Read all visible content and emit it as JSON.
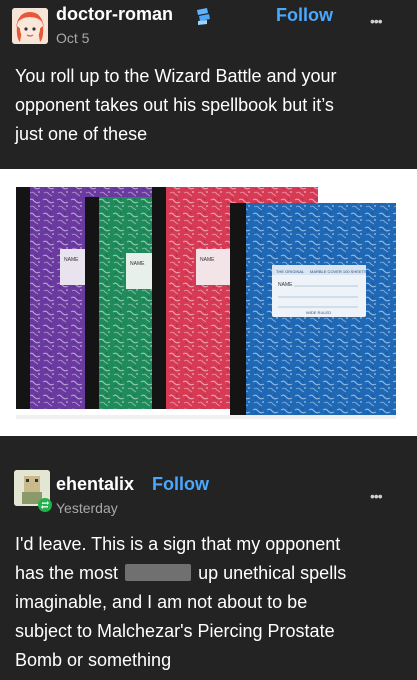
{
  "post1": {
    "username": "doctor-roman",
    "date": "Oct 5",
    "follow_label": "Follow",
    "more_label": "•••",
    "text_lines": [
      "You roll up to the Wizard Battle and your",
      "opponent takes out his spellbook but it’s",
      "just one of these"
    ],
    "notebooks": [
      {
        "color": "#6a3aa0",
        "label": "NAME"
      },
      {
        "color": "#1f8b5a",
        "label": "NAME"
      },
      {
        "color": "#d63a54",
        "label": "NAME"
      },
      {
        "color": "#1f68b6",
        "label": "NAME",
        "header": "THE ORIGINAL",
        "subheader": "MARBLE COVER 100 SHEETS",
        "footer": "WIDE RULED"
      }
    ]
  },
  "post2": {
    "username": "ehentalix",
    "date": "Yesterday",
    "follow_label": "Follow",
    "more_label": "•••",
    "line1": "I'd leave. This is a sign that my opponent",
    "line2a": "has the most",
    "line2b": "up unethical spells",
    "line3": "imaginable, and I am not about to be",
    "line4": "subject to Malchezar's Piercing Prostate",
    "line5": "Bomb or something"
  },
  "colors": {
    "background": "#232323",
    "link": "#4aa8ff",
    "muted": "#a9a9a9",
    "reblog_badge": "#22b24c"
  }
}
